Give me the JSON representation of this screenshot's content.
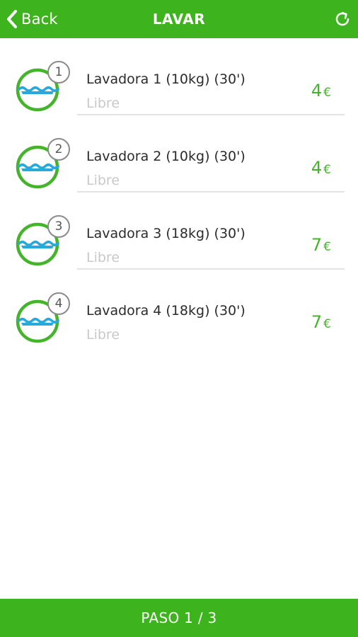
{
  "header": {
    "back_label": "Back",
    "title": "LAVAR",
    "back_icon": "chevron-left-icon",
    "refresh_icon": "refresh-icon"
  },
  "colors": {
    "brand_green": "#3db31d",
    "price_green": "#44b52a",
    "water_blue": "#29a8dc",
    "status_gray": "#c9c9c9"
  },
  "machines": [
    {
      "number": "1",
      "name": "Lavadora 1 (10kg) (30')",
      "status": "Libre",
      "price": "4",
      "currency": "€",
      "icon": "washing-machine-icon"
    },
    {
      "number": "2",
      "name": "Lavadora 2 (10kg) (30')",
      "status": "Libre",
      "price": "4",
      "currency": "€",
      "icon": "washing-machine-icon"
    },
    {
      "number": "3",
      "name": "Lavadora 3 (18kg) (30')",
      "status": "Libre",
      "price": "7",
      "currency": "€",
      "icon": "washing-machine-icon"
    },
    {
      "number": "4",
      "name": "Lavadora 4 (18kg) (30')",
      "status": "Libre",
      "price": "7",
      "currency": "€",
      "icon": "washing-machine-icon"
    }
  ],
  "footer": {
    "step_label": "PASO 1 / 3"
  }
}
